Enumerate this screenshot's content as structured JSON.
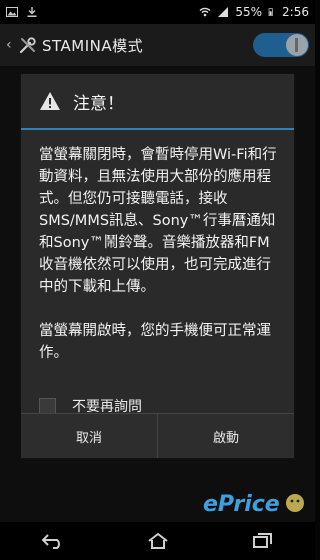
{
  "status_bar": {
    "battery": "55%",
    "time": "2:56"
  },
  "action_bar": {
    "title": "STAMINA模式",
    "toggle_on": true
  },
  "dialog": {
    "title": "注意！",
    "body_1": "當螢幕關閉時，會暫時停用Wi-Fi和行動資料，且無法使用大部份的應用程式。但您仍可接聽電話，接收SMS/MMS訊息、Sony™行事曆通知和Sony™鬧鈴聲。音樂播放器和FM收音機依然可以使用，也可完成進行中的下載和上傳。",
    "body_2": "當螢幕開啟時，您的手機便可正常運作。",
    "checkbox_label": "不要再詢問",
    "checkbox_checked": false,
    "cancel_label": "取消",
    "confirm_label": "啟動"
  },
  "watermark": {
    "text": "ePrice"
  },
  "colors": {
    "accent": "#2f83b8",
    "toggle": "#1f5f8f",
    "dialog_bg": "#2a2a2a"
  }
}
